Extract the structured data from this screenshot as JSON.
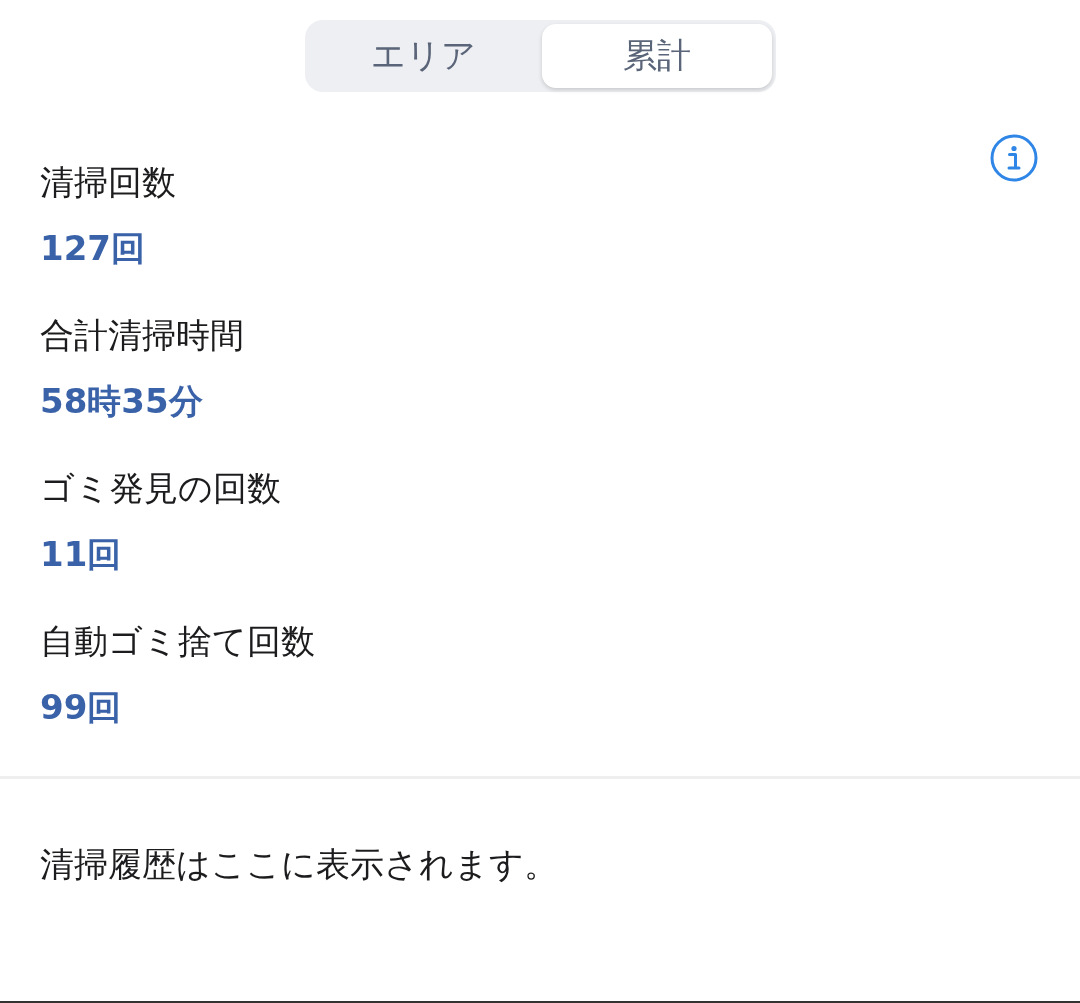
{
  "segmented_control": {
    "tabs": [
      {
        "label": "エリア",
        "selected": false
      },
      {
        "label": "累計",
        "selected": true
      }
    ]
  },
  "stats": [
    {
      "label": "清掃回数",
      "value": "127回"
    },
    {
      "label": "合計清掃時間",
      "value": "58時35分"
    },
    {
      "label": "ゴミ発見の回数",
      "value": "11回"
    },
    {
      "label": "自動ゴミ捨て回数",
      "value": "99回"
    }
  ],
  "history": {
    "empty_message": "清掃履歴はここに表示されます。"
  }
}
